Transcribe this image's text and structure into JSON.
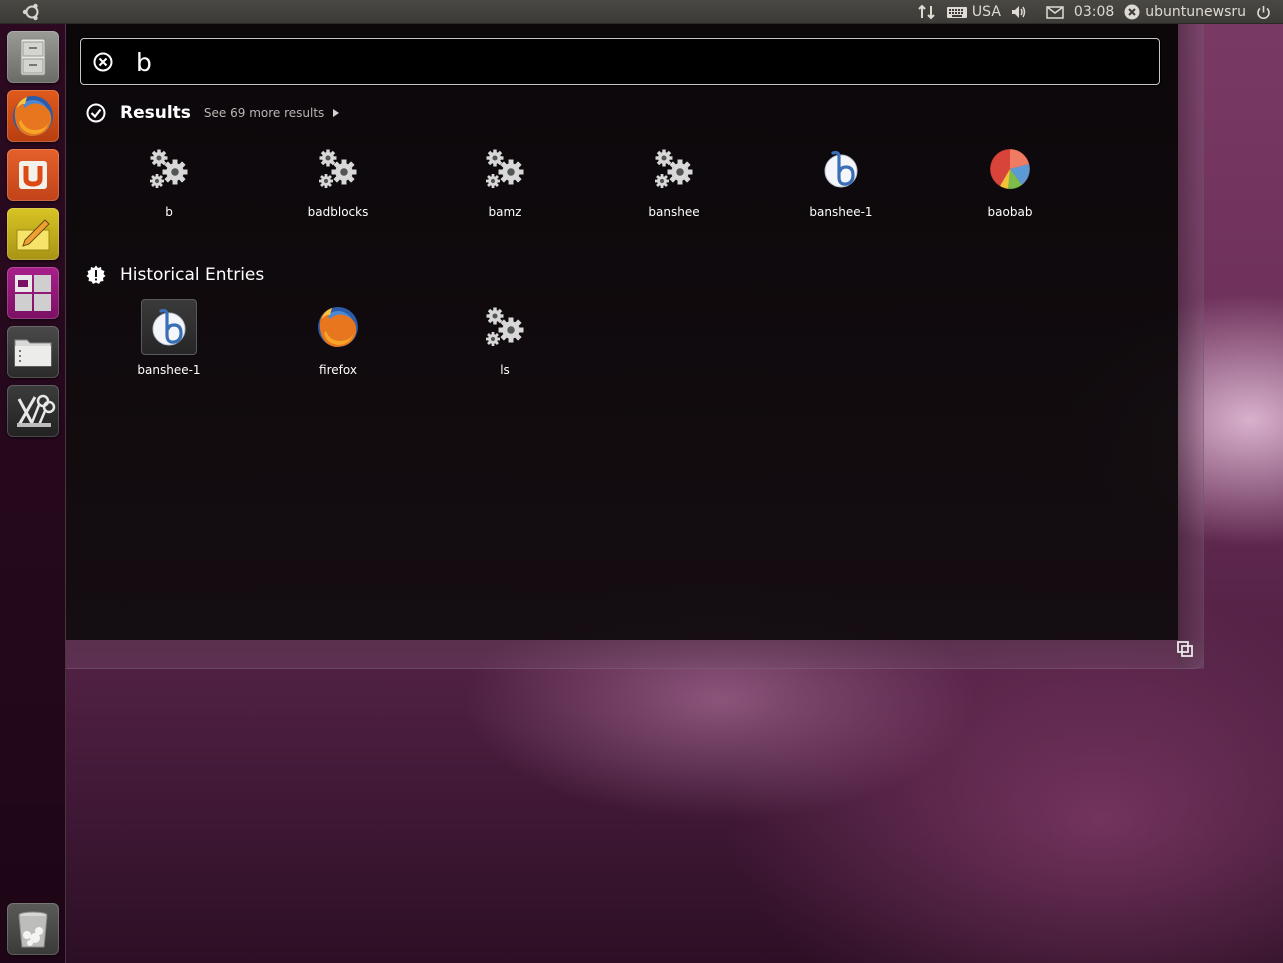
{
  "top_panel": {
    "keyboard_layout": "USA",
    "clock": "03:08",
    "user": "ubuntunewsru",
    "icons": [
      "ubuntu-logo-icon",
      "network-icon",
      "keyboard-icon",
      "volume-icon",
      "mail-icon",
      "user-status-icon",
      "power-icon"
    ]
  },
  "launcher": {
    "items": [
      {
        "name": "file-cabinet-icon"
      },
      {
        "name": "firefox-icon"
      },
      {
        "name": "ubuntu-one-icon"
      },
      {
        "name": "notes-icon"
      },
      {
        "name": "workspaces-icon"
      },
      {
        "name": "files-folder-icon"
      },
      {
        "name": "tools-icon"
      },
      {
        "name": "trash-icon"
      }
    ]
  },
  "search": {
    "query": "b"
  },
  "results": {
    "title": "Results",
    "see_more": "See 69 more results",
    "items": [
      {
        "label": "b",
        "icon": "gears-icon"
      },
      {
        "label": "badblocks",
        "icon": "gears-icon"
      },
      {
        "label": "bamz",
        "icon": "gears-icon"
      },
      {
        "label": "banshee",
        "icon": "gears-icon"
      },
      {
        "label": "banshee-1",
        "icon": "banshee-icon"
      },
      {
        "label": "baobab",
        "icon": "baobab-icon"
      }
    ]
  },
  "history": {
    "title": "Historical Entries",
    "items": [
      {
        "label": "banshee-1",
        "icon": "banshee-icon"
      },
      {
        "label": "firefox",
        "icon": "firefox-icon"
      },
      {
        "label": "ls",
        "icon": "gears-icon"
      }
    ]
  }
}
